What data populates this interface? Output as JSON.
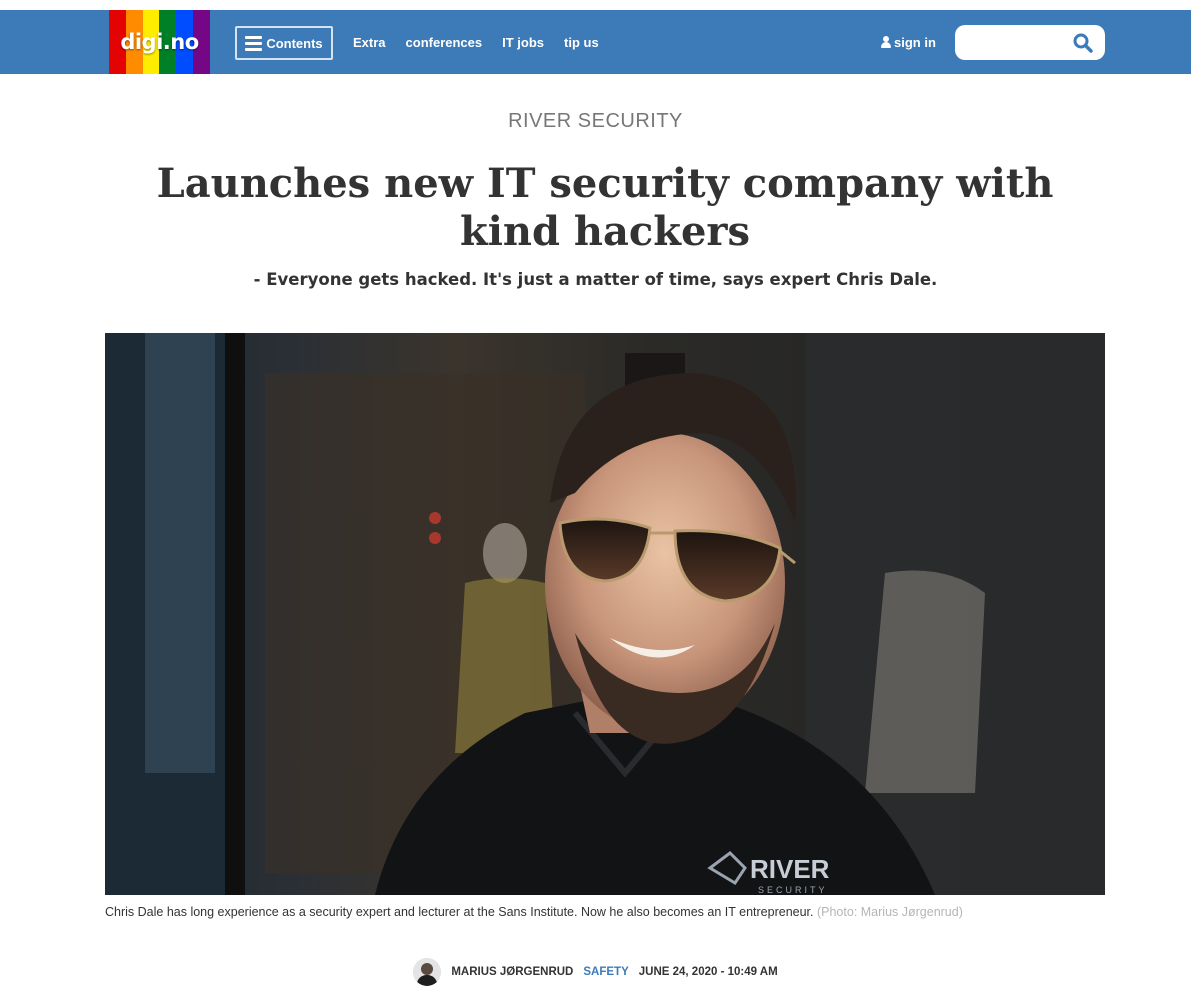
{
  "header": {
    "logo_text": "digi.no",
    "logo_colors": [
      "#e40303",
      "#ff8c00",
      "#ffed00",
      "#008026",
      "#004dff",
      "#750787"
    ],
    "brand_color": "#3d7ab8",
    "contents_label": "Contents",
    "nav_items": [
      "Extra",
      "conferences",
      "IT jobs",
      "tip us"
    ],
    "signin_label": "sign in",
    "search_placeholder": ""
  },
  "article": {
    "kicker": "RIVER SECURITY",
    "headline": "Launches new IT security company with kind hackers",
    "lead": "- Everyone gets hacked. It's just a matter of time, says expert Chris Dale.",
    "photo_shirt_text": "RIVER",
    "photo_shirt_subtext": "SECURITY",
    "caption": "Chris Dale has long experience as a security expert and lecturer at the Sans Institute. Now he also becomes an IT entrepreneur.",
    "caption_credit": "(Photo: Marius Jørgenrud)"
  },
  "byline": {
    "author": "MARIUS JØRGENRUD",
    "category": "SAFETY",
    "date": "JUNE 24, 2020 - 10:49 AM"
  }
}
